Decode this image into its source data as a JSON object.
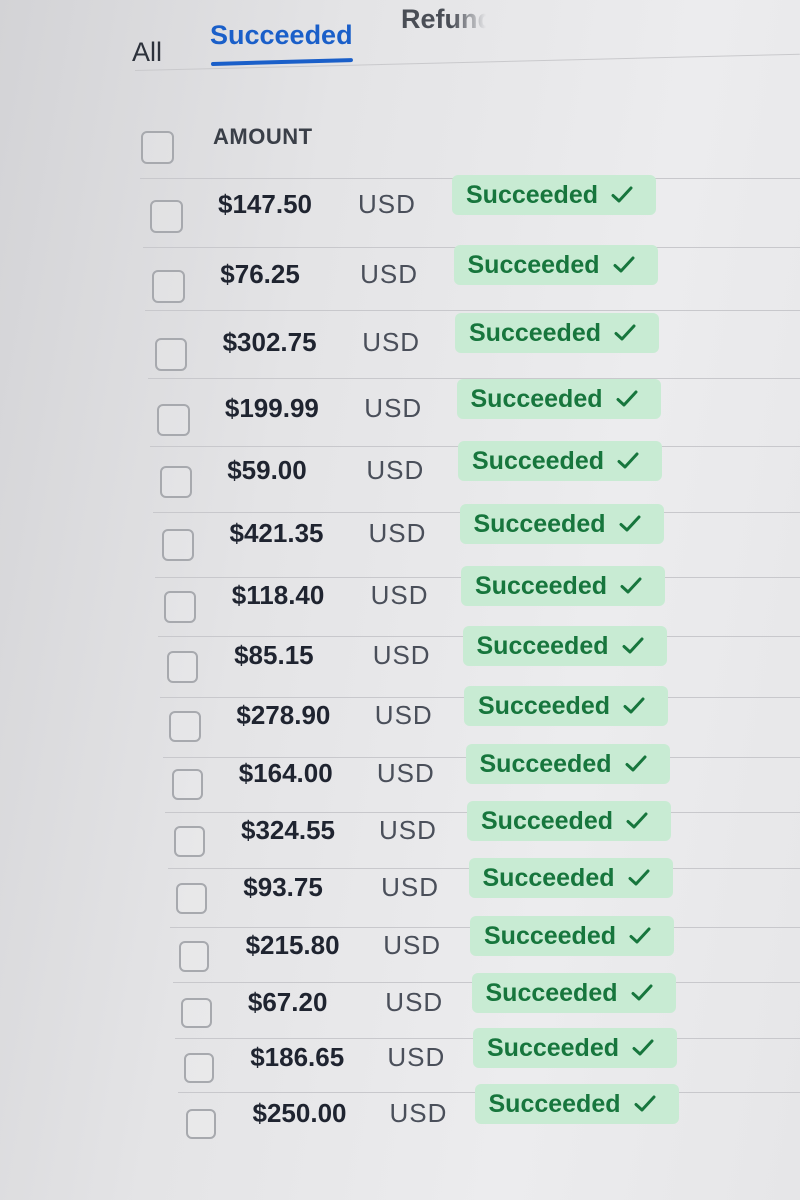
{
  "tabs": [
    {
      "label": "All"
    },
    {
      "label": "Succeeded"
    },
    {
      "label": "Refunded"
    }
  ],
  "active_tab": "Succeeded",
  "table": {
    "columns": {
      "amount": "AMOUNT"
    },
    "rows": [
      {
        "amount": "$147.50",
        "currency": "USD",
        "status": "Succeeded"
      },
      {
        "amount": "$76.25",
        "currency": "USD",
        "status": "Succeeded"
      },
      {
        "amount": "$302.75",
        "currency": "USD",
        "status": "Succeeded"
      },
      {
        "amount": "$199.99",
        "currency": "USD",
        "status": "Succeeded"
      },
      {
        "amount": "$59.00",
        "currency": "USD",
        "status": "Succeeded"
      },
      {
        "amount": "$421.35",
        "currency": "USD",
        "status": "Succeeded"
      },
      {
        "amount": "$118.40",
        "currency": "USD",
        "status": "Succeeded"
      },
      {
        "amount": "$85.15",
        "currency": "USD",
        "status": "Succeeded"
      },
      {
        "amount": "$278.90",
        "currency": "USD",
        "status": "Succeeded"
      },
      {
        "amount": "$164.00",
        "currency": "USD",
        "status": "Succeeded"
      },
      {
        "amount": "$324.55",
        "currency": "USD",
        "status": "Succeeded"
      },
      {
        "amount": "$93.75",
        "currency": "USD",
        "status": "Succeeded"
      },
      {
        "amount": "$215.80",
        "currency": "USD",
        "status": "Succeeded"
      },
      {
        "amount": "$67.20",
        "currency": "USD",
        "status": "Succeeded"
      },
      {
        "amount": "$186.65",
        "currency": "USD",
        "status": "Succeeded"
      },
      {
        "amount": "$250.00",
        "currency": "USD",
        "status": "Succeeded"
      }
    ]
  },
  "colors": {
    "accent": "#1a5fc9",
    "status_success_bg": "#c8ebd3",
    "status_success_text": "#17763d"
  },
  "icons": {
    "status_check": "checkmark-icon",
    "row_select": "checkbox"
  }
}
